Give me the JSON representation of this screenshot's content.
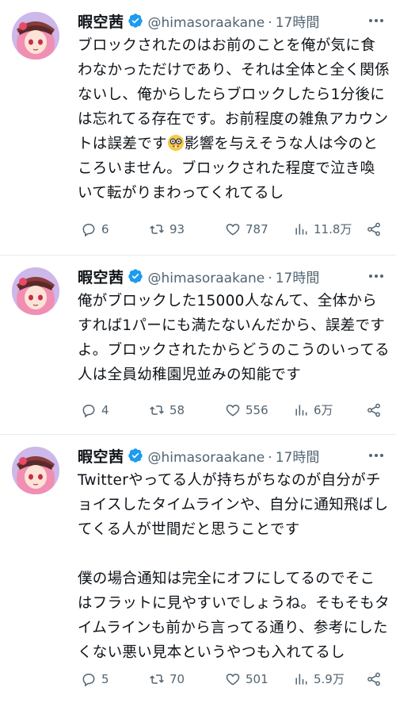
{
  "colors": {
    "verified": "#1d9bf0",
    "muted": "#536471",
    "divider": "#e6ecf0"
  },
  "tweets": [
    {
      "name": "暇空茜",
      "handle": "@himasoraakane",
      "dot": "·",
      "time": "17時間",
      "text_before_emoji": "ブロックされたのはお前のことを俺が気に食わなかっただけであり、それは全体と全く関係ないし、俺からしたらブロックしたら1分後には忘れてる存在です。お前程度の雑魚アカウントは誤差です",
      "emoji": "nerd-face",
      "text_after_emoji": "影響を与えそうな人は今のところいません。ブロックされた程度で泣き喚いて転がりまわってくれてるし",
      "replies": "6",
      "retweets": "93",
      "likes": "787",
      "views": "11.8万"
    },
    {
      "name": "暇空茜",
      "handle": "@himasoraakane",
      "dot": "·",
      "time": "17時間",
      "text": "俺がブロックした15000人なんて、全体からすれば1パーにも満たないんだから、誤差ですよ。ブロックされたからどうのこうのいってる人は全員幼稚園児並みの知能です",
      "replies": "4",
      "retweets": "58",
      "likes": "556",
      "views": "6万"
    },
    {
      "name": "暇空茜",
      "handle": "@himasoraakane",
      "dot": "·",
      "time": "17時間",
      "text": "Twitterやってる人が持ちがちなのが自分がチョイスしたタイムラインや、自分に通知飛ばしてくる人が世間だと思うことです\n\n僕の場合通知は完全にオフにしてるのでそこはフラットに見やすいでしょうね。そもそもタイムラインも前から言ってる通り、参考にしたくない悪い見本というやつも入れてるし",
      "replies": "5",
      "retweets": "70",
      "likes": "501",
      "views": "5.9万"
    }
  ]
}
